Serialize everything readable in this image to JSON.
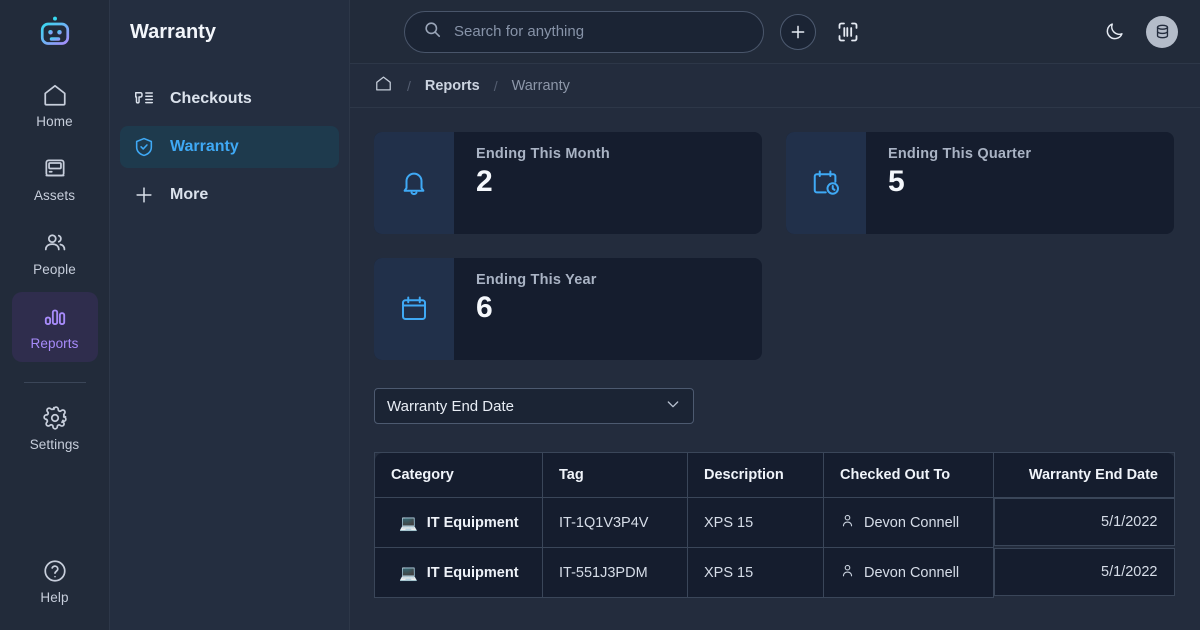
{
  "brand": {
    "logo_icon": "robot-head-icon"
  },
  "rail": {
    "items": [
      {
        "label": "Home",
        "icon": "home-icon",
        "active": false
      },
      {
        "label": "Assets",
        "icon": "monitor-icon",
        "active": false
      },
      {
        "label": "People",
        "icon": "people-icon",
        "active": false
      },
      {
        "label": "Reports",
        "icon": "bar-chart-icon",
        "active": true
      }
    ],
    "settings": {
      "label": "Settings",
      "icon": "gear-icon"
    },
    "help": {
      "label": "Help",
      "icon": "question-circle-icon"
    }
  },
  "subnav": {
    "title": "Warranty",
    "items": [
      {
        "label": "Checkouts",
        "icon": "barcode-scanner-icon",
        "active": false
      },
      {
        "label": "Warranty",
        "icon": "shield-check-icon",
        "active": true
      },
      {
        "label": "More",
        "icon": "plus-icon",
        "active": false
      }
    ]
  },
  "topbar": {
    "search": {
      "placeholder": "Search for anything",
      "value": "",
      "icon": "search-icon"
    },
    "add_button": {
      "icon": "plus-icon",
      "label": "+"
    },
    "scan_button": {
      "icon": "barcode-scan-icon"
    },
    "theme_toggle": {
      "icon": "moon-icon"
    },
    "avatar": {
      "icon": "database-icon"
    }
  },
  "breadcrumb": {
    "home_icon": "home-icon",
    "separator": "/",
    "items": [
      {
        "label": "Reports",
        "current": false
      },
      {
        "label": "Warranty",
        "current": true
      }
    ]
  },
  "stats": [
    {
      "label": "Ending This Month",
      "value": "2",
      "icon": "bell-icon",
      "accent": "#3fa9f5"
    },
    {
      "label": "Ending This Quarter",
      "value": "5",
      "icon": "calendar-clock-icon",
      "accent": "#3fa9f5"
    },
    {
      "label": "Ending This Year",
      "value": "6",
      "icon": "calendar-icon",
      "accent": "#3fa9f5"
    }
  ],
  "sort_select": {
    "value": "Warranty End Date",
    "icon": "chevron-down-icon"
  },
  "table": {
    "columns": [
      "Category",
      "Tag",
      "Description",
      "Checked Out To",
      "Warranty End Date"
    ],
    "rows": [
      {
        "category": "IT Equipment",
        "category_icon": "laptop-emoji",
        "tag": "IT-1Q1V3P4V",
        "description": "XPS 15",
        "checked_out_to": "Devon Connell",
        "person_icon": "person-icon",
        "warranty_end_date": "5/1/2022"
      },
      {
        "category": "IT Equipment",
        "category_icon": "laptop-emoji",
        "tag": "IT-551J3PDM",
        "description": "XPS 15",
        "checked_out_to": "Devon Connell",
        "person_icon": "person-icon",
        "warranty_end_date": "5/1/2022"
      }
    ]
  },
  "colors": {
    "accent_blue": "#3fa9f5",
    "accent_purple": "#a78bfa",
    "rail_bg": "#222b3a",
    "subnav_bg": "#242e40",
    "content_bg": "#232c3d",
    "card_bg": "#151d2e",
    "card_icon_bg": "#21304a"
  }
}
